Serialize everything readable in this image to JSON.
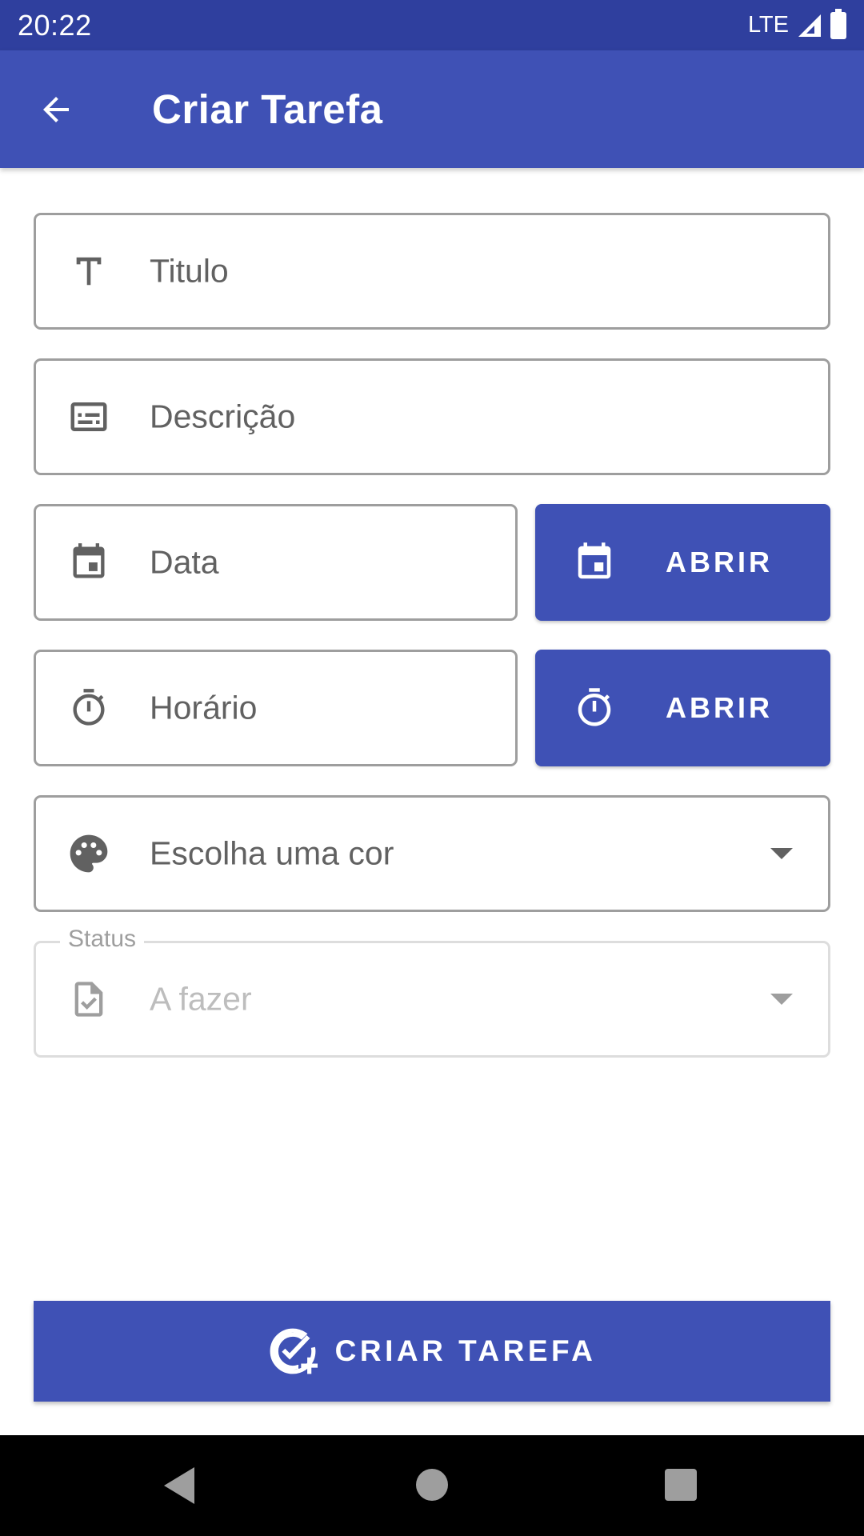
{
  "status_bar": {
    "time": "20:22",
    "network": "LTE"
  },
  "app_bar": {
    "title": "Criar Tarefa",
    "back_icon": "arrow-back-icon"
  },
  "form": {
    "title_field": {
      "placeholder": "Titulo",
      "icon": "text-format-icon"
    },
    "description_field": {
      "placeholder": "Descrição",
      "icon": "subtitles-icon"
    },
    "date_field": {
      "placeholder": "Data",
      "icon": "calendar-icon"
    },
    "date_button": {
      "label": "ABRIR",
      "icon": "calendar-icon"
    },
    "time_field": {
      "placeholder": "Horário",
      "icon": "timer-icon"
    },
    "time_button": {
      "label": "ABRIR",
      "icon": "timer-icon"
    },
    "color_select": {
      "placeholder": "Escolha uma cor",
      "icon": "palette-icon"
    },
    "status_select": {
      "label": "Status",
      "value": "A fazer",
      "icon": "task-file-icon",
      "disabled": true
    }
  },
  "submit_button": {
    "label": "CRIAR TAREFA",
    "icon": "add-task-icon"
  },
  "colors": {
    "primary": "#3f51b5",
    "status_bar": "#2f3f9e",
    "icon_gray": "#616161"
  }
}
